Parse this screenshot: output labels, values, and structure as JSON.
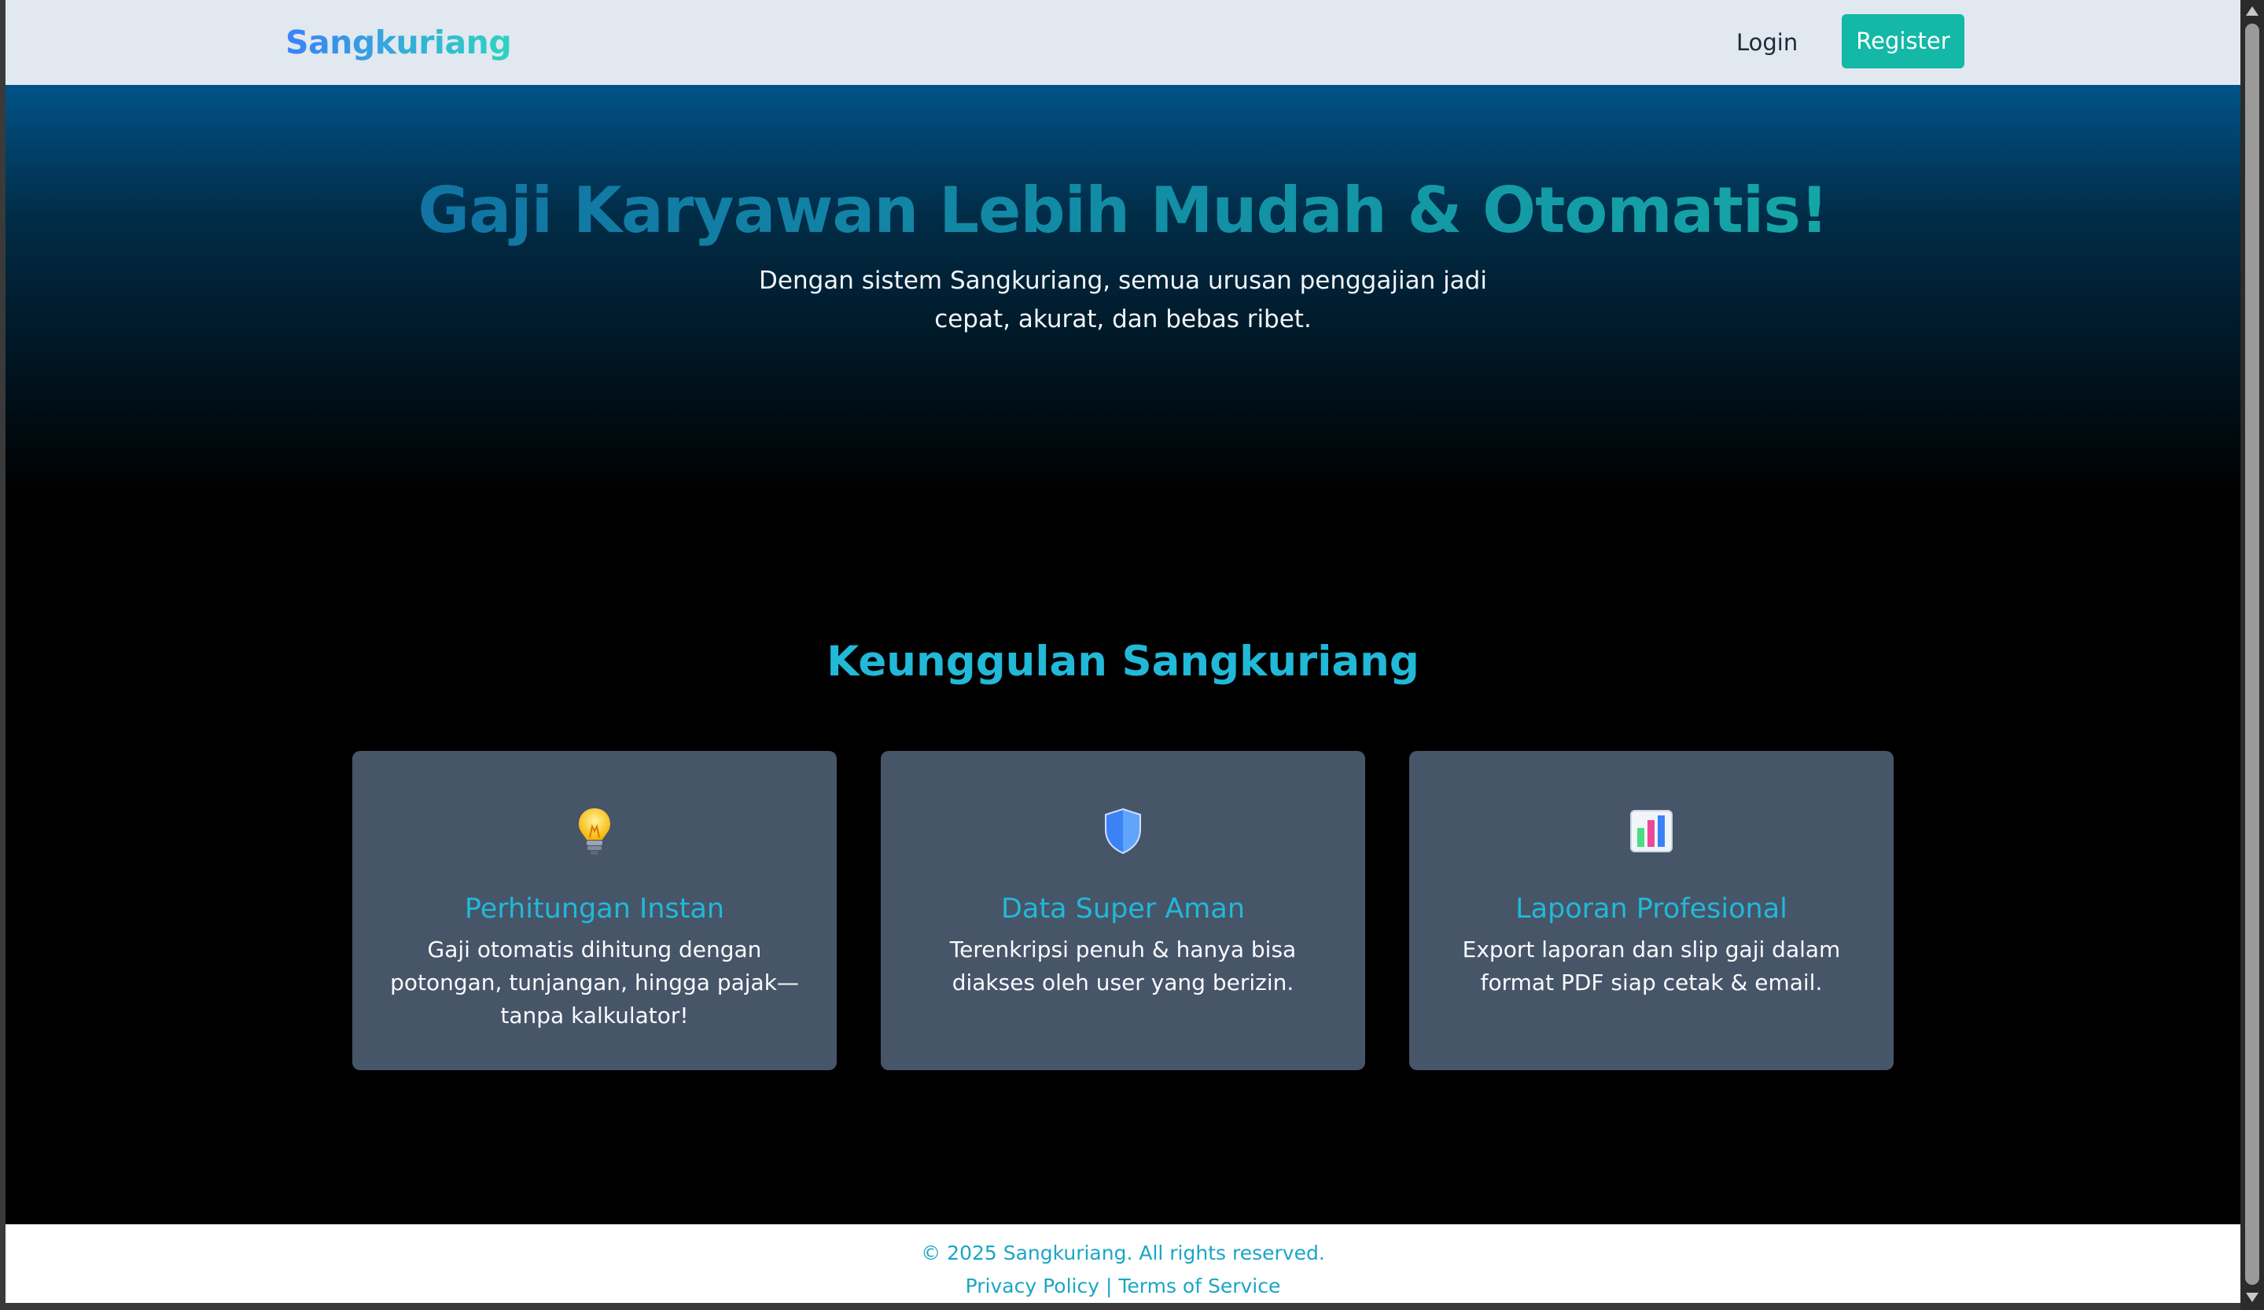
{
  "navbar": {
    "brand": "Sangkuriang",
    "login_label": "Login",
    "register_label": "Register"
  },
  "hero": {
    "title": "Gaji Karyawan Lebih Mudah & Otomatis!",
    "subtitle": "Dengan sistem Sangkuriang, semua urusan penggajian jadi cepat, akurat, dan bebas ribet."
  },
  "features": {
    "title": "Keunggulan Sangkuriang",
    "cards": [
      {
        "icon": "lightbulb-icon",
        "title": "Perhitungan Instan",
        "text": "Gaji otomatis dihitung dengan potongan, tunjangan, hingga pajak—tanpa kalkulator!"
      },
      {
        "icon": "shield-icon",
        "title": "Data Super Aman",
        "text": "Terenkripsi penuh & hanya bisa diakses oleh user yang berizin."
      },
      {
        "icon": "bar-chart-icon",
        "title": "Laporan Profesional",
        "text": "Export laporan dan slip gaji dalam format PDF siap cetak & email."
      }
    ]
  },
  "footer": {
    "copyright": "© 2025 Sangkuriang. All rights reserved.",
    "privacy_label": "Privacy Policy",
    "separator": "|",
    "terms_label": "Terms of Service"
  },
  "colors": {
    "accent": "#14b8a6",
    "heading": "#22b8d8",
    "card_bg": "#475569",
    "navbar_bg": "#e2e8f0"
  }
}
